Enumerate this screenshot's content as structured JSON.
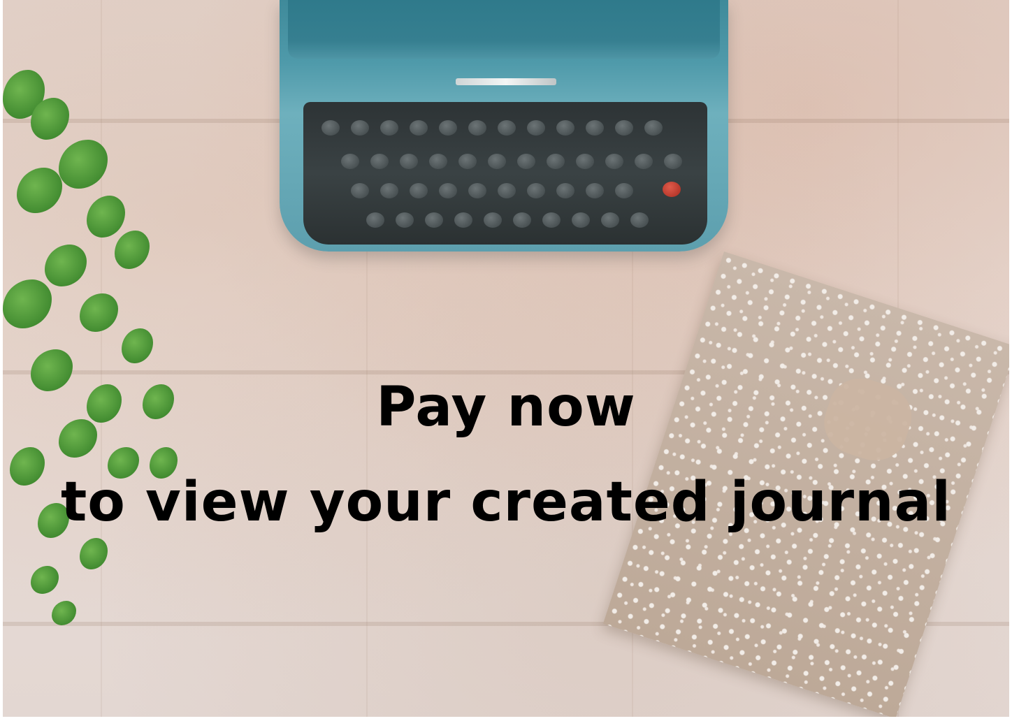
{
  "message": {
    "line1": "Pay now",
    "line2": "to view your created journal"
  },
  "background": {
    "elements": [
      "typewriter",
      "plant",
      "notebook"
    ],
    "wood_color": "#e6dbd6",
    "typewriter_color": "#4f9aaa",
    "plant_color": "#3f8f2f",
    "notebook_color": "#c7b6a8"
  }
}
